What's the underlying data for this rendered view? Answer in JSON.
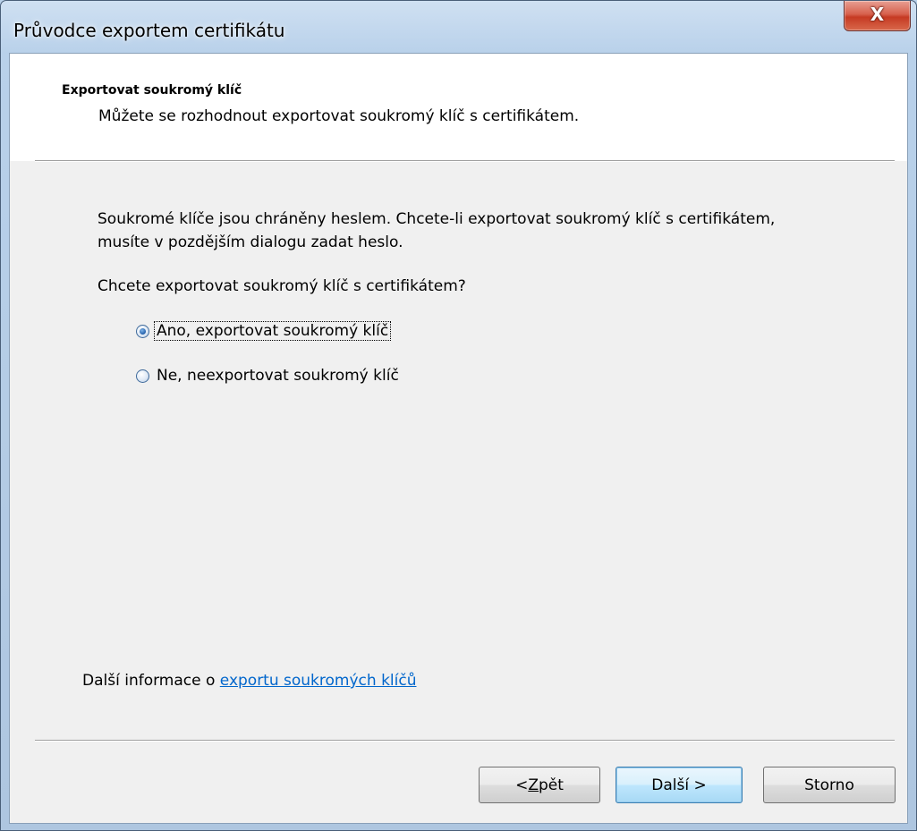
{
  "window": {
    "title": "Průvodce exportem certifikátu",
    "close_glyph": "X"
  },
  "header": {
    "title": "Exportovat soukromý klíč",
    "subtitle": "Můžete se rozhodnout exportovat soukromý klíč s certifikátem."
  },
  "body": {
    "description": "Soukromé klíče jsou chráněny heslem. Chcete-li exportovat soukromý klíč s certifikátem, musíte v pozdějším dialogu zadat heslo.",
    "question": "Chcete exportovat soukromý klíč s certifikátem?",
    "options": [
      {
        "label": "Ano, exportovat soukromý klíč",
        "selected": true
      },
      {
        "label": "Ne, neexportovat soukromý klíč",
        "selected": false
      }
    ]
  },
  "footer": {
    "more_info_prefix": "Další informace o ",
    "more_info_link": "exportu soukromých klíčů"
  },
  "buttons": {
    "back_prefix": "< ",
    "back_mnemonic": "Z",
    "back_rest": "pět",
    "next": "Další >",
    "cancel": "Storno"
  },
  "colors": {
    "link": "#0066cc",
    "window_frame": "#b9d1ea",
    "dialog_background": "#f0f0f0",
    "close_button": "#c63a23"
  }
}
